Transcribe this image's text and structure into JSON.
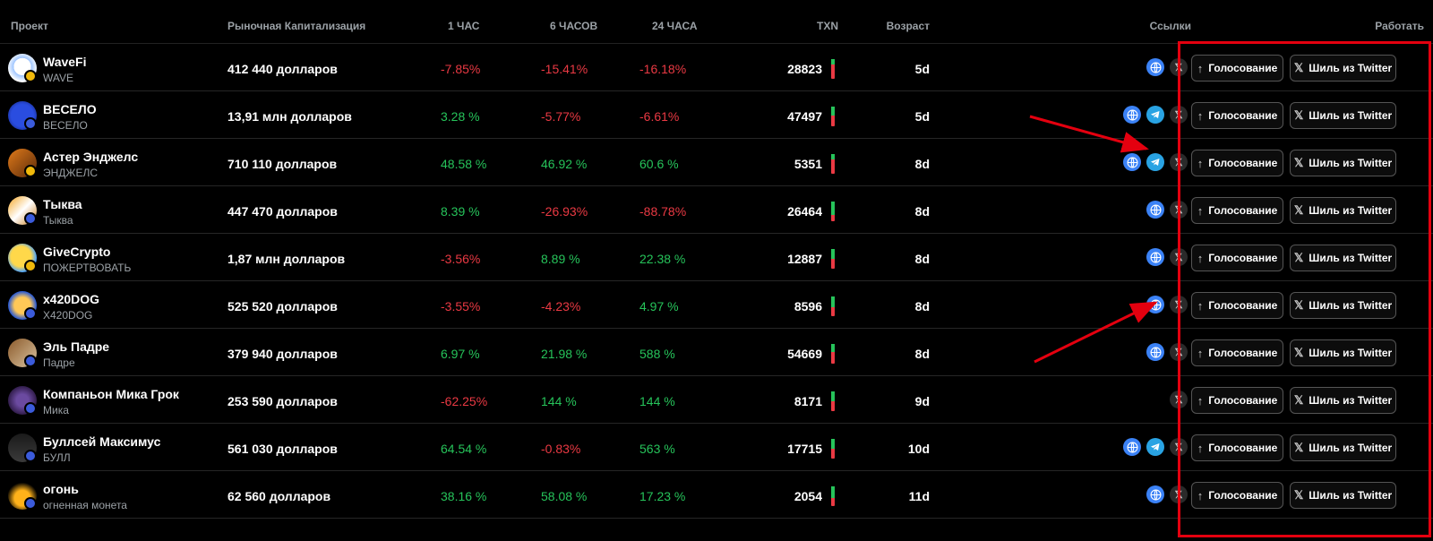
{
  "header": {
    "project": "Проект",
    "mcap": "Рыночная Капитализация",
    "h1": "1 ЧАС",
    "h6": "6 ЧАСОВ",
    "h24": "24 ЧАСА",
    "txn": "TXN",
    "age": "Возраст",
    "links": "Ссылки",
    "work": "Работать"
  },
  "buttons": {
    "vote": "Голосование",
    "shill": "Шиль из Twitter"
  },
  "colors": {
    "positive": "#26c35a",
    "negative": "#ea3943",
    "highlight": "#e4000f",
    "bnb": "#f0b90b",
    "sol": "#3b5bdb"
  },
  "rows": [
    {
      "name": "WaveFi",
      "ticker": "WAVE",
      "mcap": "412 440 долларов",
      "h1": "-7.85%",
      "h6": "-15.41%",
      "h24": "-16.18%",
      "txn": "28823",
      "age": "5d",
      "links": [
        "globe",
        "x"
      ],
      "chain": "bnb",
      "txn_buy_share": 0.25
    },
    {
      "name": "ВЕСЕЛО",
      "ticker": "ВЕСЕЛО",
      "mcap": "13,91 млн долларов",
      "h1": "3.28 %",
      "h6": "-5.77%",
      "h24": "-6.61%",
      "txn": "47497",
      "age": "5d",
      "links": [
        "globe",
        "telegram",
        "x"
      ],
      "chain": "sol",
      "txn_buy_share": 0.45
    },
    {
      "name": "Астер Энджелс",
      "ticker": "ЭНДЖЕЛС",
      "mcap": "710 110 долларов",
      "h1": "48.58 %",
      "h6": "46.92 %",
      "h24": "60.6 %",
      "txn": "5351",
      "age": "8d",
      "links": [
        "globe",
        "telegram",
        "x"
      ],
      "chain": "bnb",
      "txn_buy_share": 0.25
    },
    {
      "name": "Тыква",
      "ticker": "Тыква",
      "mcap": "447 470 долларов",
      "h1": "8.39 %",
      "h6": "-26.93%",
      "h24": "-88.78%",
      "txn": "26464",
      "age": "8d",
      "links": [
        "globe",
        "x"
      ],
      "chain": "sol",
      "txn_buy_share": 0.7
    },
    {
      "name": "GiveCrypto",
      "ticker": "ПОЖЕРТВОВАТЬ",
      "mcap": "1,87 млн долларов",
      "h1": "-3.56%",
      "h6": "8.89 %",
      "h24": "22.38 %",
      "txn": "12887",
      "age": "8d",
      "links": [
        "globe",
        "x"
      ],
      "chain": "bnb",
      "txn_buy_share": 0.5
    },
    {
      "name": "x420DOG",
      "ticker": "X420DOG",
      "mcap": "525 520 долларов",
      "h1": "-3.55%",
      "h6": "-4.23%",
      "h24": "4.97 %",
      "txn": "8596",
      "age": "8d",
      "links": [
        "globe",
        "x"
      ],
      "chain": "sol",
      "txn_buy_share": 0.55
    },
    {
      "name": "Эль Падре",
      "ticker": "Падре",
      "mcap": "379 940 долларов",
      "h1": "6.97 %",
      "h6": "21.98 %",
      "h24": "588 %",
      "txn": "54669",
      "age": "8d",
      "links": [
        "globe",
        "x"
      ],
      "chain": "sol",
      "txn_buy_share": 0.4
    },
    {
      "name": "Компаньон Мика Грок",
      "ticker": "Мика",
      "mcap": "253 590 долларов",
      "h1": "-62.25%",
      "h6": "144 %",
      "h24": "144 %",
      "txn": "8171",
      "age": "9d",
      "links": [
        "x"
      ],
      "chain": "sol",
      "txn_buy_share": 0.5
    },
    {
      "name": "Буллсей Максимус",
      "ticker": "БУЛЛ",
      "mcap": "561 030 долларов",
      "h1": "64.54 %",
      "h6": "-0.83%",
      "h24": "563 %",
      "txn": "17715",
      "age": "10d",
      "links": [
        "globe",
        "telegram",
        "x"
      ],
      "chain": "sol",
      "txn_buy_share": 0.5
    },
    {
      "name": "огонь",
      "ticker": "огненная монета",
      "mcap": "62 560 долларов",
      "h1": "38.16 %",
      "h6": "58.08 %",
      "h24": "17.23 %",
      "txn": "2054",
      "age": "11d",
      "links": [
        "globe",
        "x"
      ],
      "chain": "sol",
      "txn_buy_share": 0.6
    }
  ]
}
